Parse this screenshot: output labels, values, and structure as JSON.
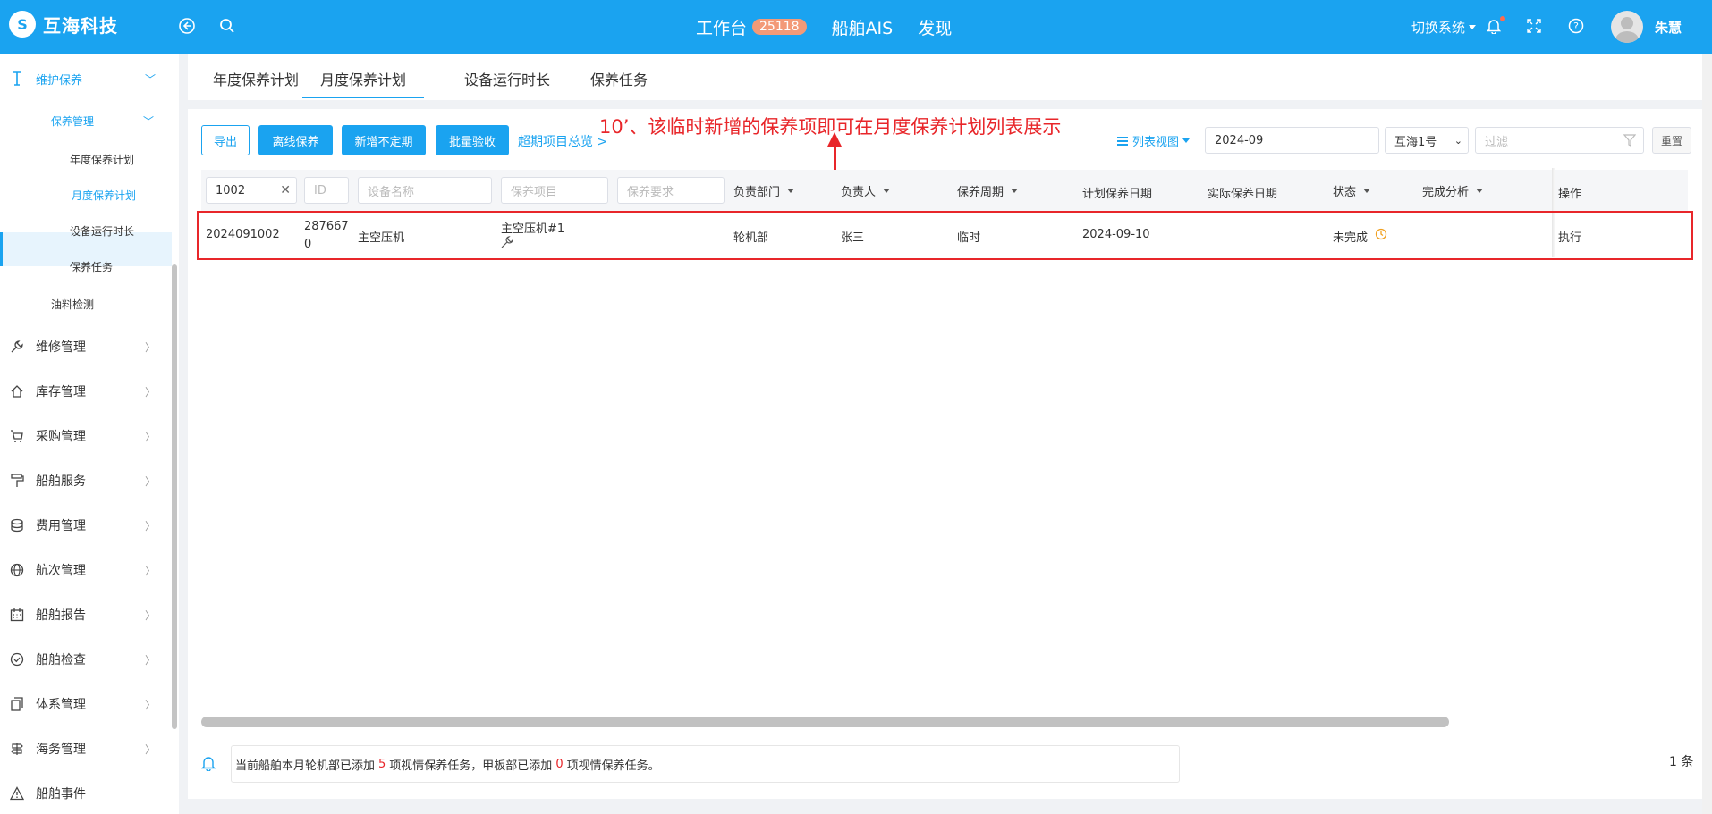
{
  "header": {
    "logo_text": "互海科技",
    "nav": [
      {
        "label": "工作台",
        "badge": "25118"
      },
      {
        "label": "船舶AIS"
      },
      {
        "label": "发现"
      }
    ],
    "switch_system": "切换系统",
    "username": "朱慧"
  },
  "sidebar": {
    "items": [
      {
        "label": "维护保养",
        "icon": "maintenance-icon"
      },
      {
        "label": "保养管理"
      },
      {
        "label": "年度保养计划"
      },
      {
        "label": "月度保养计划"
      },
      {
        "label": "设备运行时长"
      },
      {
        "label": "保养任务"
      },
      {
        "label": "油料检测"
      },
      {
        "label": "维修管理",
        "icon": "wrench-icon"
      },
      {
        "label": "库存管理",
        "icon": "home-icon"
      },
      {
        "label": "采购管理",
        "icon": "cart-icon"
      },
      {
        "label": "船舶服务",
        "icon": "paint-roller-icon"
      },
      {
        "label": "费用管理",
        "icon": "coins-icon"
      },
      {
        "label": "航次管理",
        "icon": "globe-icon"
      },
      {
        "label": "船舶报告",
        "icon": "calendar-icon"
      },
      {
        "label": "船舶检查",
        "icon": "check-circle-icon"
      },
      {
        "label": "体系管理",
        "icon": "documents-icon"
      },
      {
        "label": "海务管理",
        "icon": "signpost-icon"
      },
      {
        "label": "船舶事件",
        "icon": "warning-icon"
      }
    ]
  },
  "tabs": [
    "年度保养计划",
    "月度保养计划",
    "设备运行时长",
    "保养任务"
  ],
  "toolbar": {
    "export": "导出",
    "offline": "离线保养",
    "add_irregular": "新增不定期",
    "batch_accept": "批量验收",
    "overdue_link": "超期项目总览 >",
    "view": "列表视图",
    "month": "2024-09",
    "ship": "互海1号",
    "filter_placeholder": "过滤",
    "reset": "重置"
  },
  "annotation": "10’、该临时新增的保养项即可在月度保养计划列表展示",
  "table": {
    "filters": {
      "code": "1002",
      "id_placeholder": "ID",
      "equipment_placeholder": "设备名称",
      "item_placeholder": "保养项目",
      "requirement_placeholder": "保养要求"
    },
    "columns": [
      "负责部门",
      "负责人",
      "保养周期",
      "计划保养日期",
      "实际保养日期",
      "状态",
      "完成分析",
      "操作"
    ],
    "rows": [
      {
        "code": "2024091002",
        "id_line1": "287667",
        "id_line2": "0",
        "equipment": "主空压机",
        "item": "主空压机#1",
        "department": "轮机部",
        "owner": "张三",
        "cycle": "临时",
        "planned_date": "2024-09-10",
        "actual_date": "",
        "status": "未完成",
        "action": "执行"
      }
    ]
  },
  "footer": {
    "notice_prefix": "当前船舶本月轮机部已添加",
    "engine_count": "5",
    "notice_mid": "项视情保养任务，甲板部已添加",
    "deck_count": "0",
    "notice_suffix": "项视情保养任务。",
    "total": "1 条"
  }
}
